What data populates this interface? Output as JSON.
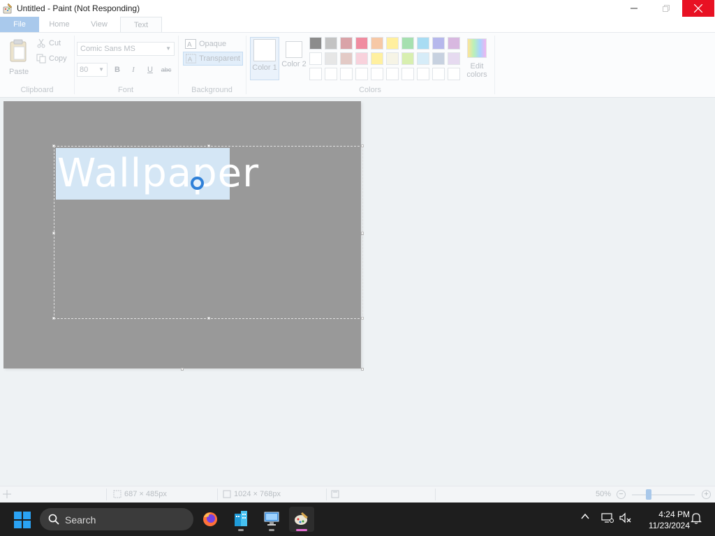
{
  "window": {
    "title": "Untitled - Paint (Not Responding)"
  },
  "tabs": [
    {
      "label": "File"
    },
    {
      "label": "Home"
    },
    {
      "label": "View"
    },
    {
      "label": "Text"
    }
  ],
  "ribbon": {
    "clipboard": {
      "label": "Clipboard",
      "paste": "Paste",
      "cut": "Cut",
      "copy": "Copy"
    },
    "font": {
      "label": "Font",
      "family": "Comic Sans MS",
      "size": "80",
      "bold": "B",
      "italic": "I",
      "underline": "U",
      "strikethrough": "abc"
    },
    "background": {
      "label": "Background",
      "opaque": "Opaque",
      "transparent": "Transparent",
      "selected": "Transparent"
    },
    "colors": {
      "label": "Colors",
      "color1": "Color 1",
      "color2": "Color 2",
      "edit": "Edit colors",
      "color1_value": "#ffffff",
      "color2_value": "#ffffff",
      "palette_row1": [
        "#8c8c8c",
        "#c3c3c3",
        "#d9a3a8",
        "#f08ca0",
        "#f6c8a6",
        "#ffef9e",
        "#a6e0b0",
        "#a8dcf3",
        "#b6b8ec",
        "#d8b8e0"
      ],
      "palette_row2": [
        "#ffffff",
        "#e6e6e6",
        "#e3cac6",
        "#f8d2dc",
        "#fff0a0",
        "#f6f4e6",
        "#d8efb0",
        "#d6ecf8",
        "#c7d1e0",
        "#e6daf0"
      ],
      "palette_row3": [
        "#ffffff",
        "#ffffff",
        "#ffffff",
        "#ffffff",
        "#ffffff",
        "#ffffff",
        "#ffffff",
        "#ffffff",
        "#ffffff",
        "#ffffff"
      ]
    }
  },
  "canvas": {
    "text": "Wallpaper",
    "background": "#999999"
  },
  "status": {
    "selection_size": "687 × 485px",
    "image_size": "1024 × 768px",
    "zoom": "50%"
  },
  "taskbar": {
    "search": "Search",
    "time": "4:24 PM",
    "date": "11/23/2024"
  },
  "colors": {
    "accent": "#2f80d8",
    "close": "#e81123"
  }
}
